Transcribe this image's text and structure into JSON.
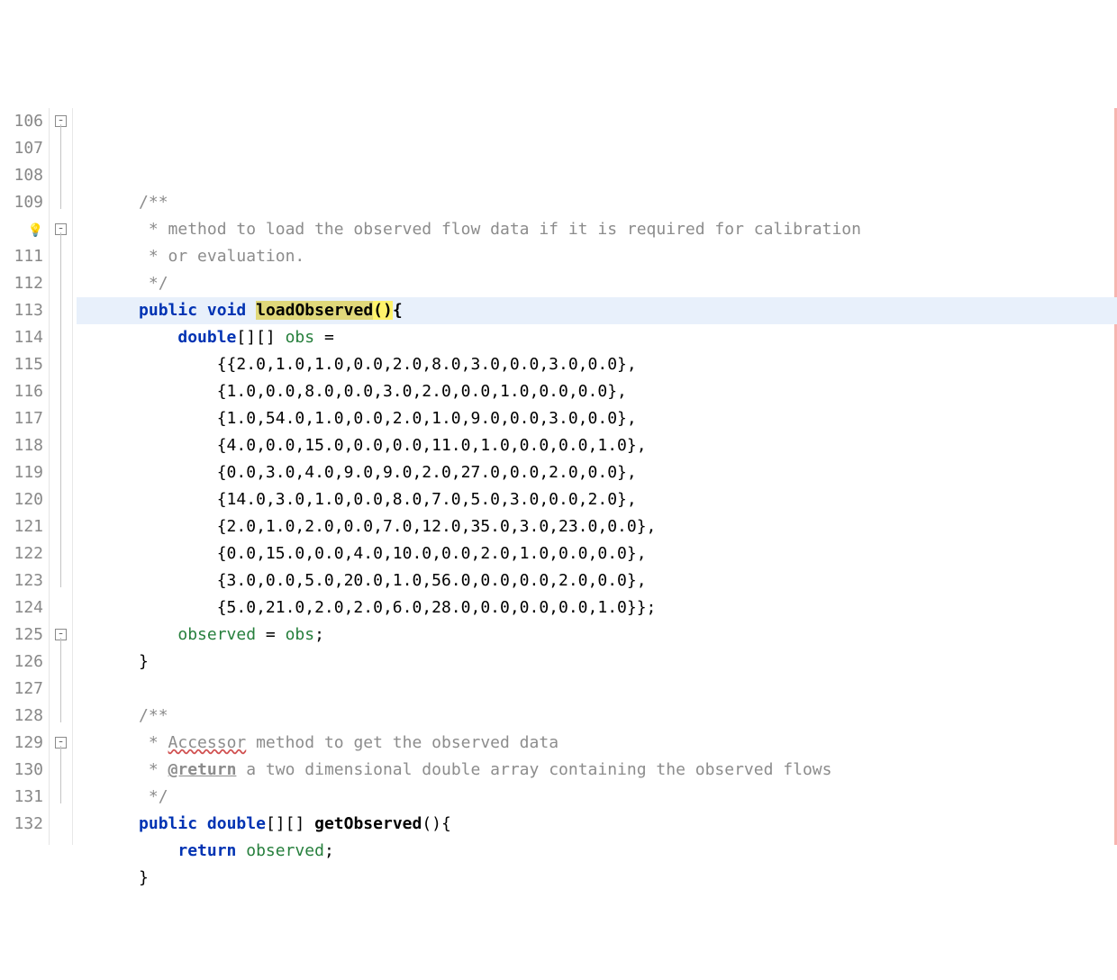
{
  "startLine": 106,
  "highlightedLine": 110,
  "foldMarkers": {
    "106": "start",
    "110": "start",
    "125": "start",
    "129": "start"
  },
  "foldLines": [
    {
      "from": 106,
      "to": 109
    },
    {
      "from": 110,
      "to": 123
    },
    {
      "from": 125,
      "to": 128
    },
    {
      "from": 129,
      "to": 131
    }
  ],
  "bulbLine": 110,
  "lines": [
    {
      "n": 106,
      "ind": "    ",
      "tokens": [
        {
          "t": "/**",
          "c": "cmt"
        }
      ]
    },
    {
      "n": 107,
      "ind": "     ",
      "tokens": [
        {
          "t": "* method to load the observed flow data if it is required for calibration",
          "c": "cmt"
        }
      ]
    },
    {
      "n": 108,
      "ind": "     ",
      "tokens": [
        {
          "t": "* or evaluation.",
          "c": "cmt"
        }
      ]
    },
    {
      "n": 109,
      "ind": "     ",
      "tokens": [
        {
          "t": "*/",
          "c": "cmt"
        }
      ]
    },
    {
      "n": 110,
      "ind": "    ",
      "tokens": [
        {
          "t": "public",
          "c": "kw"
        },
        {
          "t": " "
        },
        {
          "t": "void",
          "c": "kw"
        },
        {
          "t": " "
        },
        {
          "t": "loadObserved",
          "c": "mnamehl"
        },
        {
          "t": "()",
          "c": "parenhl"
        },
        {
          "t": "{",
          "c": "mname"
        }
      ]
    },
    {
      "n": 111,
      "ind": "        ",
      "tokens": [
        {
          "t": "double",
          "c": "kw"
        },
        {
          "t": "[][] "
        },
        {
          "t": "obs",
          "c": "local"
        },
        {
          "t": " ="
        }
      ]
    },
    {
      "n": 112,
      "ind": "            ",
      "tokens": [
        {
          "t": "{{2.0,1.0,1.0,0.0,2.0,8.0,3.0,0.0,3.0,0.0},"
        }
      ]
    },
    {
      "n": 113,
      "ind": "            ",
      "tokens": [
        {
          "t": "{1.0,0.0,8.0,0.0,3.0,2.0,0.0,1.0,0.0,0.0},"
        }
      ]
    },
    {
      "n": 114,
      "ind": "            ",
      "tokens": [
        {
          "t": "{1.0,54.0,1.0,0.0,2.0,1.0,9.0,0.0,3.0,0.0},"
        }
      ]
    },
    {
      "n": 115,
      "ind": "            ",
      "tokens": [
        {
          "t": "{4.0,0.0,15.0,0.0,0.0,11.0,1.0,0.0,0.0,1.0},"
        }
      ]
    },
    {
      "n": 116,
      "ind": "            ",
      "tokens": [
        {
          "t": "{0.0,3.0,4.0,9.0,9.0,2.0,27.0,0.0,2.0,0.0},"
        }
      ]
    },
    {
      "n": 117,
      "ind": "            ",
      "tokens": [
        {
          "t": "{14.0,3.0,1.0,0.0,8.0,7.0,5.0,3.0,0.0,2.0},"
        }
      ]
    },
    {
      "n": 118,
      "ind": "            ",
      "tokens": [
        {
          "t": "{2.0,1.0,2.0,0.0,7.0,12.0,35.0,3.0,23.0,0.0},"
        }
      ]
    },
    {
      "n": 119,
      "ind": "            ",
      "tokens": [
        {
          "t": "{0.0,15.0,0.0,4.0,10.0,0.0,2.0,1.0,0.0,0.0},"
        }
      ]
    },
    {
      "n": 120,
      "ind": "            ",
      "tokens": [
        {
          "t": "{3.0,0.0,5.0,20.0,1.0,56.0,0.0,0.0,2.0,0.0},"
        }
      ]
    },
    {
      "n": 121,
      "ind": "            ",
      "tokens": [
        {
          "t": "{5.0,21.0,2.0,2.0,6.0,28.0,0.0,0.0,0.0,1.0}};"
        }
      ]
    },
    {
      "n": 122,
      "ind": "        ",
      "tokens": [
        {
          "t": "observed",
          "c": "local"
        },
        {
          "t": " = "
        },
        {
          "t": "obs",
          "c": "local"
        },
        {
          "t": ";"
        }
      ]
    },
    {
      "n": 123,
      "ind": "    ",
      "tokens": [
        {
          "t": "}"
        }
      ]
    },
    {
      "n": 124,
      "ind": "",
      "tokens": []
    },
    {
      "n": 125,
      "ind": "    ",
      "tokens": [
        {
          "t": "/**",
          "c": "cmt"
        }
      ]
    },
    {
      "n": 126,
      "ind": "     ",
      "tokens": [
        {
          "t": "* ",
          "c": "cmt"
        },
        {
          "t": "Accessor",
          "c": "spell"
        },
        {
          "t": " method to get the observed data",
          "c": "cmt"
        }
      ]
    },
    {
      "n": 127,
      "ind": "     ",
      "tokens": [
        {
          "t": "* ",
          "c": "cmt"
        },
        {
          "t": "@return",
          "c": "doctag"
        },
        {
          "t": " a two dimensional double array containing the observed flows",
          "c": "cmt"
        }
      ]
    },
    {
      "n": 128,
      "ind": "     ",
      "tokens": [
        {
          "t": "*/",
          "c": "cmt"
        }
      ]
    },
    {
      "n": 129,
      "ind": "    ",
      "tokens": [
        {
          "t": "public",
          "c": "kw"
        },
        {
          "t": " "
        },
        {
          "t": "double",
          "c": "kw"
        },
        {
          "t": "[][] "
        },
        {
          "t": "getObserved",
          "c": "mname"
        },
        {
          "t": "(){"
        }
      ]
    },
    {
      "n": 130,
      "ind": "        ",
      "tokens": [
        {
          "t": "return",
          "c": "kw"
        },
        {
          "t": " "
        },
        {
          "t": "observed",
          "c": "local"
        },
        {
          "t": ";"
        }
      ]
    },
    {
      "n": 131,
      "ind": "    ",
      "tokens": [
        {
          "t": "}"
        }
      ]
    },
    {
      "n": 132,
      "ind": "",
      "tokens": []
    }
  ]
}
